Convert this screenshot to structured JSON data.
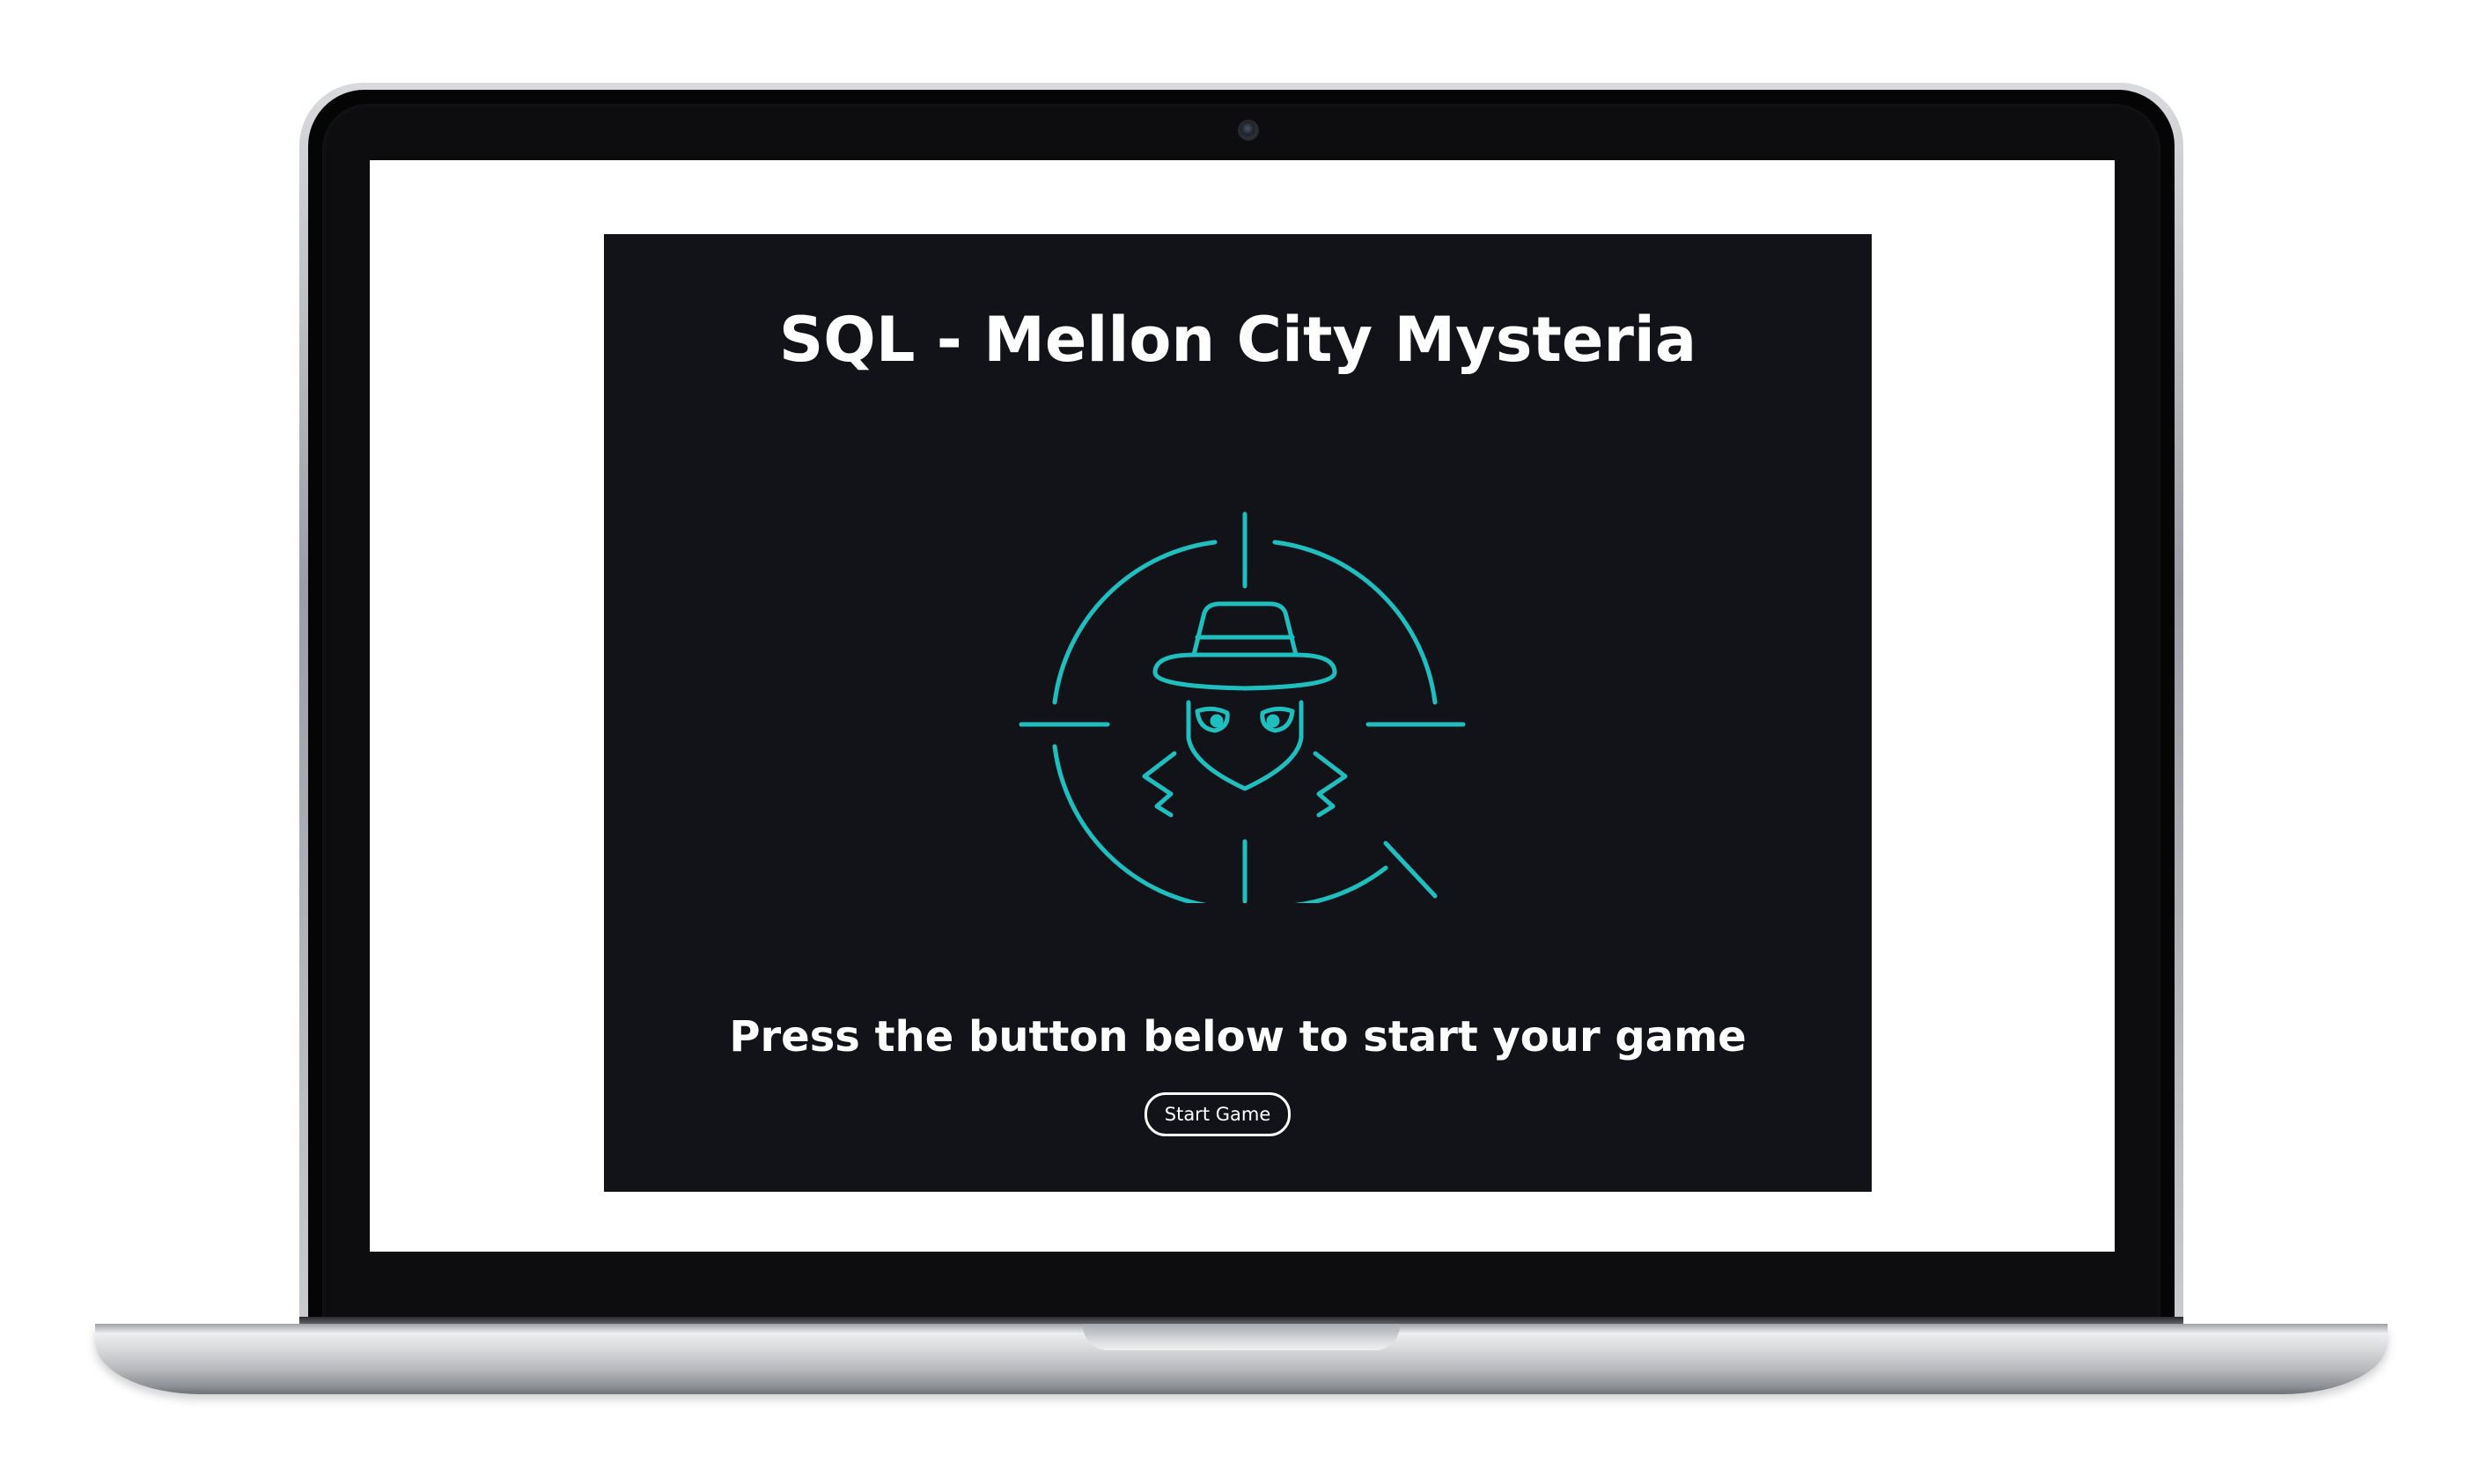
{
  "game": {
    "title": "SQL - Mellon City Mysteria",
    "subtitle": "Press the button below to start your game",
    "start_button_label": "Start Game"
  },
  "icons": {
    "hero": "detective-in-crosshair-icon"
  },
  "colors": {
    "panel_background": "#121318",
    "accent": "#1fbfbf",
    "text": "#ffffff",
    "screen_background": "#ffffff"
  }
}
